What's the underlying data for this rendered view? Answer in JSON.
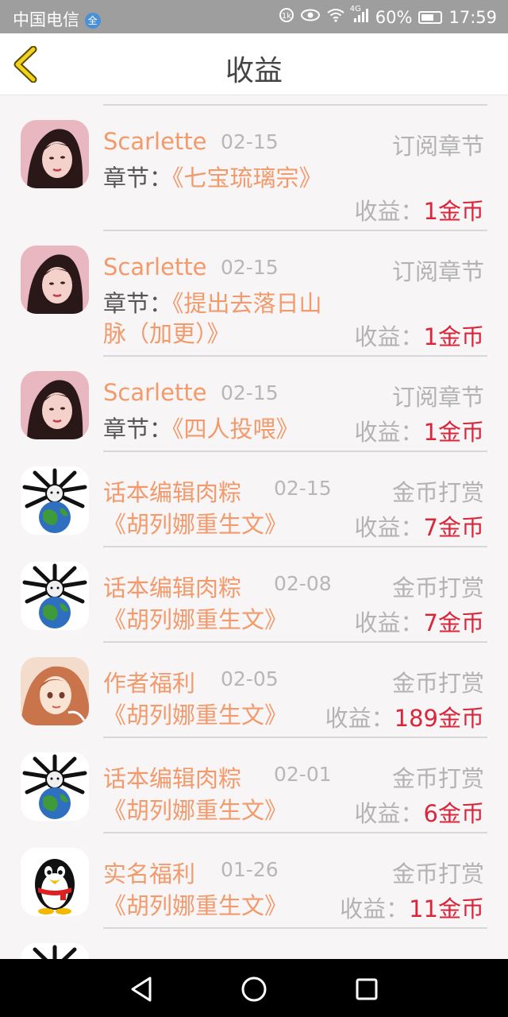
{
  "status_bar": {
    "carrier": "中国电信",
    "network_badge": "全",
    "signal_label": "4G",
    "battery": "60%",
    "time": "17:59",
    "icons": [
      "hd-icon",
      "eye-icon",
      "wifi-icon",
      "signal-icon",
      "battery-icon"
    ]
  },
  "header": {
    "title": "收益",
    "back_icon": "chevron-left-icon"
  },
  "earnings_label": "收益：",
  "chapter_prefix": "章节：",
  "items": [
    {
      "name": "Scarlette",
      "date": "02-15",
      "type": "订阅章节",
      "chapter": "《七宝琉璃宗》",
      "amount": "1金币",
      "avatar": "portrait-avatar"
    },
    {
      "name": "Scarlette",
      "date": "02-15",
      "type": "订阅章节",
      "chapter": "《提出去落日山脉（加更）》",
      "amount": "1金币",
      "avatar": "portrait-avatar"
    },
    {
      "name": "Scarlette",
      "date": "02-15",
      "type": "订阅章节",
      "chapter": "《四人投喂》",
      "amount": "1金币",
      "avatar": "portrait-avatar"
    },
    {
      "name": "话本编辑肉粽",
      "date": "02-15",
      "type": "金币打赏",
      "book": "《胡列娜重生文》",
      "amount": "7金币",
      "avatar": "globe-creature-avatar"
    },
    {
      "name": "话本编辑肉粽",
      "date": "02-08",
      "type": "金币打赏",
      "book": "《胡列娜重生文》",
      "amount": "7金币",
      "avatar": "globe-creature-avatar"
    },
    {
      "name": "作者福利",
      "date": "02-05",
      "type": "金币打赏",
      "book": "《胡列娜重生文》",
      "amount": "189金币",
      "avatar": "anime-girl-avatar"
    },
    {
      "name": "话本编辑肉粽",
      "date": "02-01",
      "type": "金币打赏",
      "book": "《胡列娜重生文》",
      "amount": "6金币",
      "avatar": "globe-creature-avatar"
    },
    {
      "name": "实名福利",
      "date": "01-26",
      "type": "金币打赏",
      "book": "《胡列娜重生文》",
      "amount": "11金币",
      "avatar": "penguin-avatar"
    }
  ],
  "nav": {
    "back": "triangle-back-icon",
    "home": "circle-home-icon",
    "recent": "square-recent-icon"
  },
  "colors": {
    "name": "#f29a6b",
    "amount": "#d9263b",
    "muted": "#b3b3b3",
    "status_bar": "#9e9e9e"
  }
}
